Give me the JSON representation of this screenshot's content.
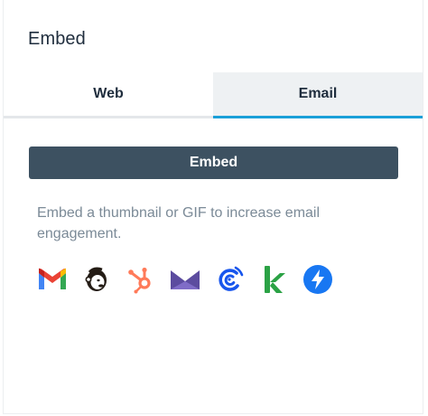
{
  "header": {
    "title": "Embed"
  },
  "tabs": [
    {
      "label": "Web",
      "active": false
    },
    {
      "label": "Email",
      "active": true
    }
  ],
  "embed_button": {
    "label": "Embed"
  },
  "description": "Embed a thumbnail or GIF to increase email engagement.",
  "integrations": [
    {
      "name": "gmail-icon",
      "color": "#EA4335"
    },
    {
      "name": "mailchimp-icon",
      "color": "#241C15"
    },
    {
      "name": "hubspot-icon",
      "color": "#FF7A59"
    },
    {
      "name": "marketo-icon",
      "color": "#5C4C9F"
    },
    {
      "name": "constant-contact-icon",
      "color": "#1856ED"
    },
    {
      "name": "klaviyo-icon",
      "color": "#2BA245"
    },
    {
      "name": "campaign-monitor-icon",
      "color": "#1877F2"
    }
  ],
  "colors": {
    "button_bg": "#3D5161",
    "active_tab_underline": "#1AA0D8",
    "active_tab_bg": "#EEF1F3",
    "description_text": "#7B8A97"
  }
}
